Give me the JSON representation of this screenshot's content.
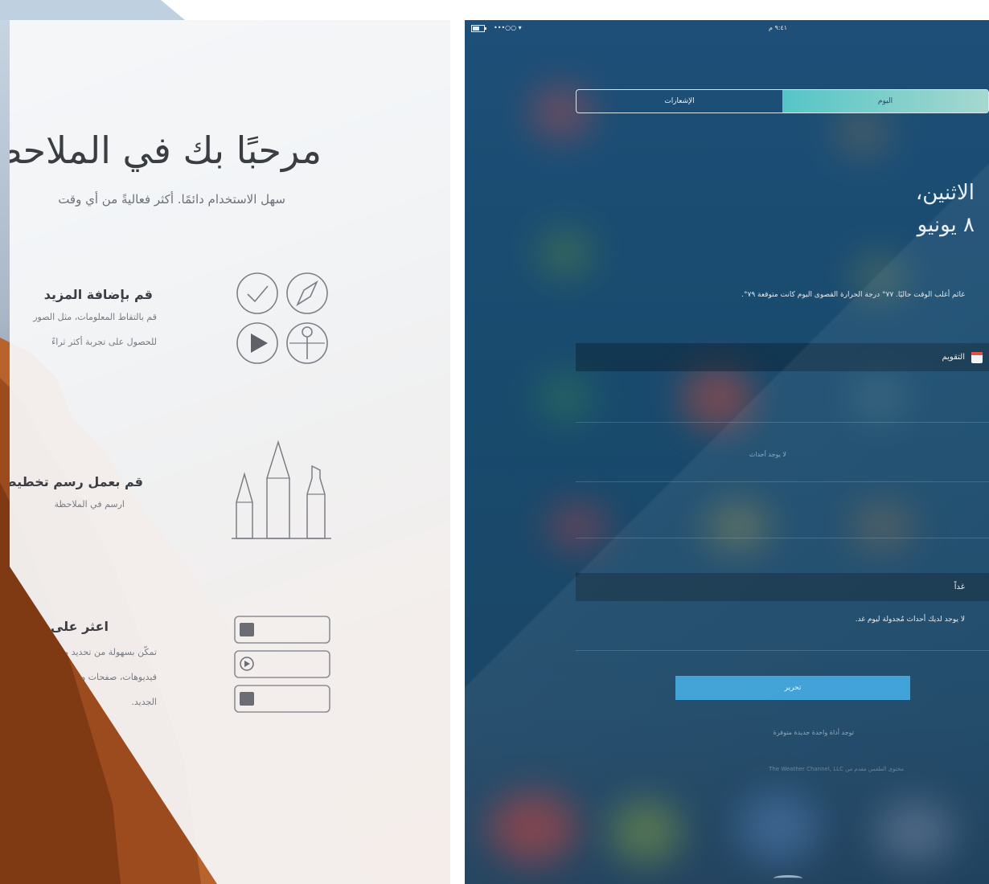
{
  "notes_welcome": {
    "title": "مرحبًا بك في الملاحظات",
    "subtitle": "سهل الاستخدام دائمًا. أكثر فعاليةً من أي وقت",
    "features": [
      {
        "title": "قم بإضافة المزيد",
        "lines": [
          "قم بالتقاط المعلومات، مثل الصور",
          "للحصول على تجربة أكثر ثراءً"
        ],
        "illustration": "attachment-icons-grid"
      },
      {
        "title": "قم بعمل رسم تخطيطي",
        "lines": [
          "ارسم في الملاحظة"
        ],
        "illustration": "drawing-tools"
      },
      {
        "title": "اعثر على المزيد",
        "lines": [
          "تمكّن بسهولة من تحديد موقع ما تبحث عنه",
          "فيديوهات، صفحات ويب، والمزيد في",
          "الجديد."
        ],
        "illustration": "attachments-list"
      }
    ]
  },
  "ipad_today": {
    "status": {
      "carrier": "•••○○ ▾",
      "time": "٩:٤١ م"
    },
    "tabs": [
      {
        "label": "اليوم",
        "active": true
      },
      {
        "label": "الإشعارات",
        "active": false
      }
    ],
    "date_line1": "الاثنين،",
    "date_line2": "٨ يونيو",
    "weather_text": "غائم أغلب الوقت حاليًا. ٧٧° درجة الحرارة القصوى اليوم كانت متوقعة ٧٩°.",
    "calendar_label": "التقويم",
    "no_events": "لا يوجد أحداث",
    "tomorrow_label": "غداً",
    "tomorrow_text": "لا يوجد لديك أحداث مُجدولة ليوم غد.",
    "edit_label": "تحرير",
    "new_widgets": "توجد أداة واحدة جديدة متوفرة",
    "footer_text": "محتوى الطقس مقدم من The Weather Channel, LLC"
  },
  "colors": {
    "tab_active": "#55c5c6",
    "edit_button": "#3a9fd6",
    "ipad_bg": "#1d4f78"
  }
}
